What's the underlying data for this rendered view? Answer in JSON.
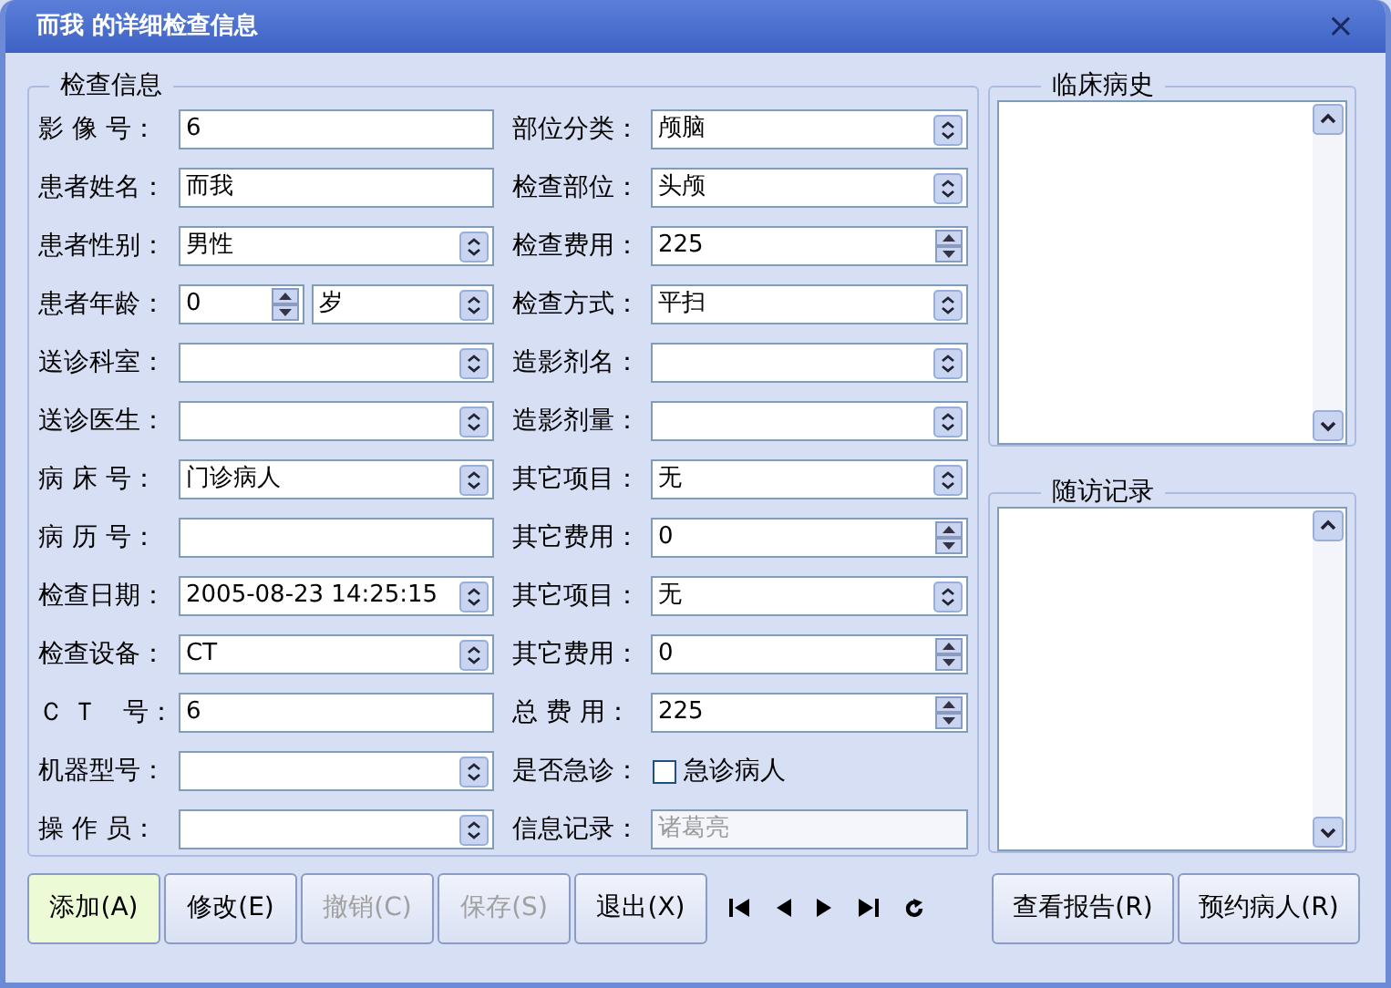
{
  "window": {
    "title": "而我 的详细检查信息",
    "close": "×"
  },
  "exam_group": {
    "title": "检查信息",
    "rows": [
      [
        {
          "label": "影 像 号：",
          "kind": "text",
          "value": "6"
        },
        {
          "label": "部位分类：",
          "kind": "combo",
          "value": "颅脑"
        }
      ],
      [
        {
          "label": "患者姓名：",
          "kind": "text",
          "value": "而我"
        },
        {
          "label": "检查部位：",
          "kind": "combo",
          "value": "头颅"
        }
      ],
      [
        {
          "label": "患者性别：",
          "kind": "combo",
          "value": "男性"
        },
        {
          "label": "检查费用：",
          "kind": "spin",
          "value": "225"
        }
      ],
      [
        {
          "label": "患者年龄：",
          "kind": "age",
          "value": "0",
          "unit": "岁"
        },
        {
          "label": "检查方式：",
          "kind": "combo",
          "value": "平扫"
        }
      ],
      [
        {
          "label": "送诊科室：",
          "kind": "combo"
        },
        {
          "label": "造影剂名：",
          "kind": "combo"
        }
      ],
      [
        {
          "label": "送诊医生：",
          "kind": "combo"
        },
        {
          "label": "造影剂量：",
          "kind": "combo"
        }
      ],
      [
        {
          "label": "病 床 号：",
          "kind": "combo",
          "value": "门诊病人"
        },
        {
          "label": "其它项目：",
          "kind": "combo",
          "value": "无"
        }
      ],
      [
        {
          "label": "病 历 号：",
          "kind": "text"
        },
        {
          "label": "其它费用：",
          "kind": "spin",
          "value": "0"
        }
      ],
      [
        {
          "label": "检查日期：",
          "kind": "combo",
          "value": "2005-08-23 14:25:15"
        },
        {
          "label": "其它项目：",
          "kind": "combo",
          "value": "无"
        }
      ],
      [
        {
          "label": "检查设备：",
          "kind": "combo",
          "value": "CT"
        },
        {
          "label": "其它费用：",
          "kind": "spin",
          "value": "0"
        }
      ],
      [
        {
          "label": "Ｃ Ｔ　号：",
          "kind": "text",
          "value": "6"
        },
        {
          "label": "总 费 用：",
          "kind": "spin",
          "value": "225"
        }
      ],
      [
        {
          "label": "机器型号：",
          "kind": "combo"
        },
        {
          "label": "是否急诊：",
          "kind": "checkbox",
          "text": "急诊病人",
          "checked": false
        }
      ],
      [
        {
          "label": "操 作 员：",
          "kind": "combo"
        },
        {
          "label": "信息记录：",
          "kind": "text",
          "value": "诸葛亮",
          "disabled": true
        }
      ]
    ]
  },
  "clinical_history": {
    "title": "临床病史"
  },
  "follow_up": {
    "title": "随访记录"
  },
  "buttons": [
    {
      "label": "添加(A)",
      "highlighted": true,
      "disabled": false
    },
    {
      "label": "修改(E)",
      "highlighted": false,
      "disabled": false
    },
    {
      "label": "撤销(C)",
      "highlighted": false,
      "disabled": true
    },
    {
      "label": "保存(S)",
      "highlighted": false,
      "disabled": true
    },
    {
      "label": "退出(X)",
      "highlighted": false,
      "disabled": false
    }
  ],
  "right_buttons": [
    {
      "label": "查看报告(R)"
    },
    {
      "label": "预约病人(R)"
    }
  ]
}
